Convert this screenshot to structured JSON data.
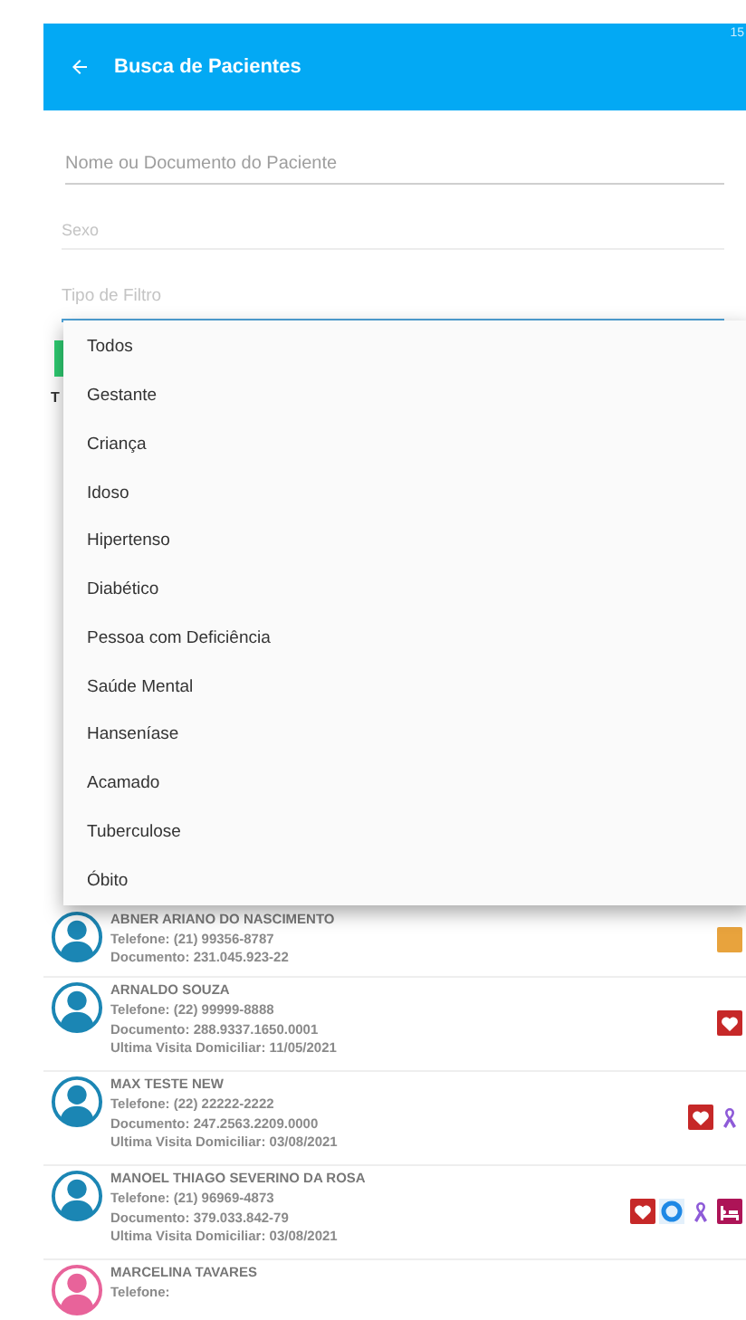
{
  "status_bar": {
    "time": "15"
  },
  "app_bar": {
    "title": "Busca de Pacientes"
  },
  "search": {
    "name_placeholder": "Nome ou Documento do Paciente",
    "sex_placeholder": "Sexo",
    "filter_placeholder": "Tipo de Filtro"
  },
  "background_text": "T",
  "filter_menu": {
    "expanded": true,
    "options": [
      {
        "label": "Todos"
      },
      {
        "label": "Gestante"
      },
      {
        "label": "Criança"
      },
      {
        "label": "Idoso"
      },
      {
        "label": "Hipertenso"
      },
      {
        "label": "Diabético"
      },
      {
        "label": "Pessoa com Deficiência"
      },
      {
        "label": "Saúde Mental"
      },
      {
        "label": "Hanseníase"
      },
      {
        "label": "Acamado"
      },
      {
        "label": "Tuberculose"
      },
      {
        "label": "Óbito"
      }
    ]
  },
  "patients": [
    {
      "name": "ABNER ARIANO DO NASCIMENTO",
      "color": "#1b86b4",
      "lines": [
        "Telefone: (21) 99356-8787",
        "Documento: 231.045.923-22"
      ],
      "tags": [
        {
          "kind": "square",
          "color": "#e8a33d"
        }
      ]
    },
    {
      "name": "ARNALDO SOUZA",
      "color": "#1b86b4",
      "lines": [
        "Telefone: (22) 99999-8888",
        "Documento: 288.9337.1650.0001",
        "Ultima Visita Domiciliar: 11/05/2021"
      ],
      "tags": [
        {
          "kind": "heart",
          "color": "#c62828"
        }
      ]
    },
    {
      "name": "MAX TESTE NEW",
      "color": "#1b86b4",
      "lines": [
        "Telefone: (22) 22222-2222",
        "Documento: 247.2563.2209.0000",
        "Ultima Visita Domiciliar: 03/08/2021"
      ],
      "tags": [
        {
          "kind": "heart",
          "color": "#c62828"
        },
        {
          "kind": "ribbon",
          "color": "#8e5bd8"
        }
      ]
    },
    {
      "name": "MANOEL THIAGO SEVERINO DA ROSA",
      "color": "#1b86b4",
      "lines": [
        "Telefone: (21) 96969-4873",
        "Documento: 379.033.842-79",
        "Ultima Visita Domiciliar: 03/08/2021"
      ],
      "tags": [
        {
          "kind": "heart",
          "color": "#c62828"
        },
        {
          "kind": "circle",
          "color": "#1e88e5"
        },
        {
          "kind": "ribbon",
          "color": "#8e5bd8"
        },
        {
          "kind": "bed",
          "color": "#ad1457"
        }
      ]
    },
    {
      "name": "MARCELINA TAVARES",
      "color": "#e8639a",
      "lines": [
        "Telefone:"
      ]
    }
  ]
}
